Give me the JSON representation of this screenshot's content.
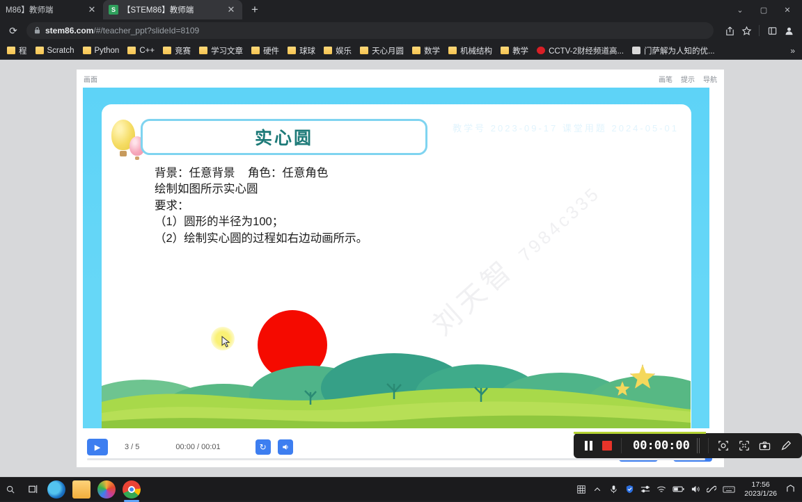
{
  "browser": {
    "tabs": [
      {
        "title": "M86】教师端",
        "favicon": "",
        "active": false,
        "close": "✕"
      },
      {
        "title": "【STEM86】教师端",
        "favicon": "S",
        "active": true,
        "close": "✕"
      }
    ],
    "new_tab_label": "+",
    "window_controls": [
      "⌄",
      "▢",
      "✕"
    ],
    "reload_icon": "⟳",
    "lock_icon": "🔒",
    "url_prefix": "stem86.com",
    "url_suffix": "/#/teacher_ppt?slideId=8109",
    "url_full": "stem86.com/#/teacher_ppt?slideId=8109",
    "toolbar_right": [
      "share-icon",
      "star-icon",
      "collections-icon",
      "profile-icon"
    ],
    "bookmarks": [
      {
        "label": "程",
        "type": "folder"
      },
      {
        "label": "Scratch",
        "type": "folder"
      },
      {
        "label": "Python",
        "type": "folder"
      },
      {
        "label": "C++",
        "type": "folder"
      },
      {
        "label": "竞赛",
        "type": "folder"
      },
      {
        "label": "学习文章",
        "type": "folder"
      },
      {
        "label": "硬件",
        "type": "folder"
      },
      {
        "label": "球球",
        "type": "folder"
      },
      {
        "label": "娱乐",
        "type": "folder"
      },
      {
        "label": "天心月圆",
        "type": "folder"
      },
      {
        "label": "数学",
        "type": "folder"
      },
      {
        "label": "机械结构",
        "type": "folder"
      },
      {
        "label": "教学",
        "type": "folder"
      },
      {
        "label": "CCTV-2财经频道高...",
        "type": "site-red"
      },
      {
        "label": "门萨解为人知的优...",
        "type": "site-grey"
      }
    ],
    "bookmarks_overflow": "»"
  },
  "app": {
    "header_left_label": "画面",
    "header_right_labels": [
      "画笔",
      "提示",
      "导航"
    ],
    "faint_header": "教学号  2023-09-17 课堂用题  2024-05-01"
  },
  "slide": {
    "title": "实心圆",
    "body_lines": [
      "背景：任意背景    角色：任意角色",
      "绘制如图所示实心圆",
      "要求：",
      "（1）圆形的半径为100；",
      "（2）绘制实心圆的过程如右边动画所示。"
    ],
    "watermark_name": "刘天智",
    "watermark_code": "7984c335",
    "circle_color": "#f50a00",
    "background_color": "#66d7f7",
    "title_color": "#1d7a78"
  },
  "player": {
    "play_icon": "▶",
    "page_count": "3 / 5",
    "time_code": "00:00 / 00:01",
    "replay_icon": "↻",
    "volume_icon": "🔊"
  },
  "recorder": {
    "pause_label": "pause",
    "stop_label": "stop",
    "timer": "00:00:00",
    "icons": [
      "target-icon",
      "resize-icon",
      "camera-icon",
      "pen-icon"
    ]
  },
  "taskbar": {
    "task_view_icon": "⊞",
    "apps": [
      {
        "name": "edge",
        "active": false
      },
      {
        "name": "files",
        "active": false
      },
      {
        "name": "photos",
        "active": false
      },
      {
        "name": "chrome",
        "active": true
      }
    ],
    "tray_icons": [
      "ime-icon",
      "chevron-up-icon",
      "microphone-icon",
      "shield-icon",
      "settings-slider-icon",
      "wifi-icon",
      "battery-icon",
      "volume-icon",
      "link-icon",
      "keyboard-icon"
    ],
    "time": "17:56",
    "date": "2023/1/26",
    "notification_icon": "▯"
  }
}
